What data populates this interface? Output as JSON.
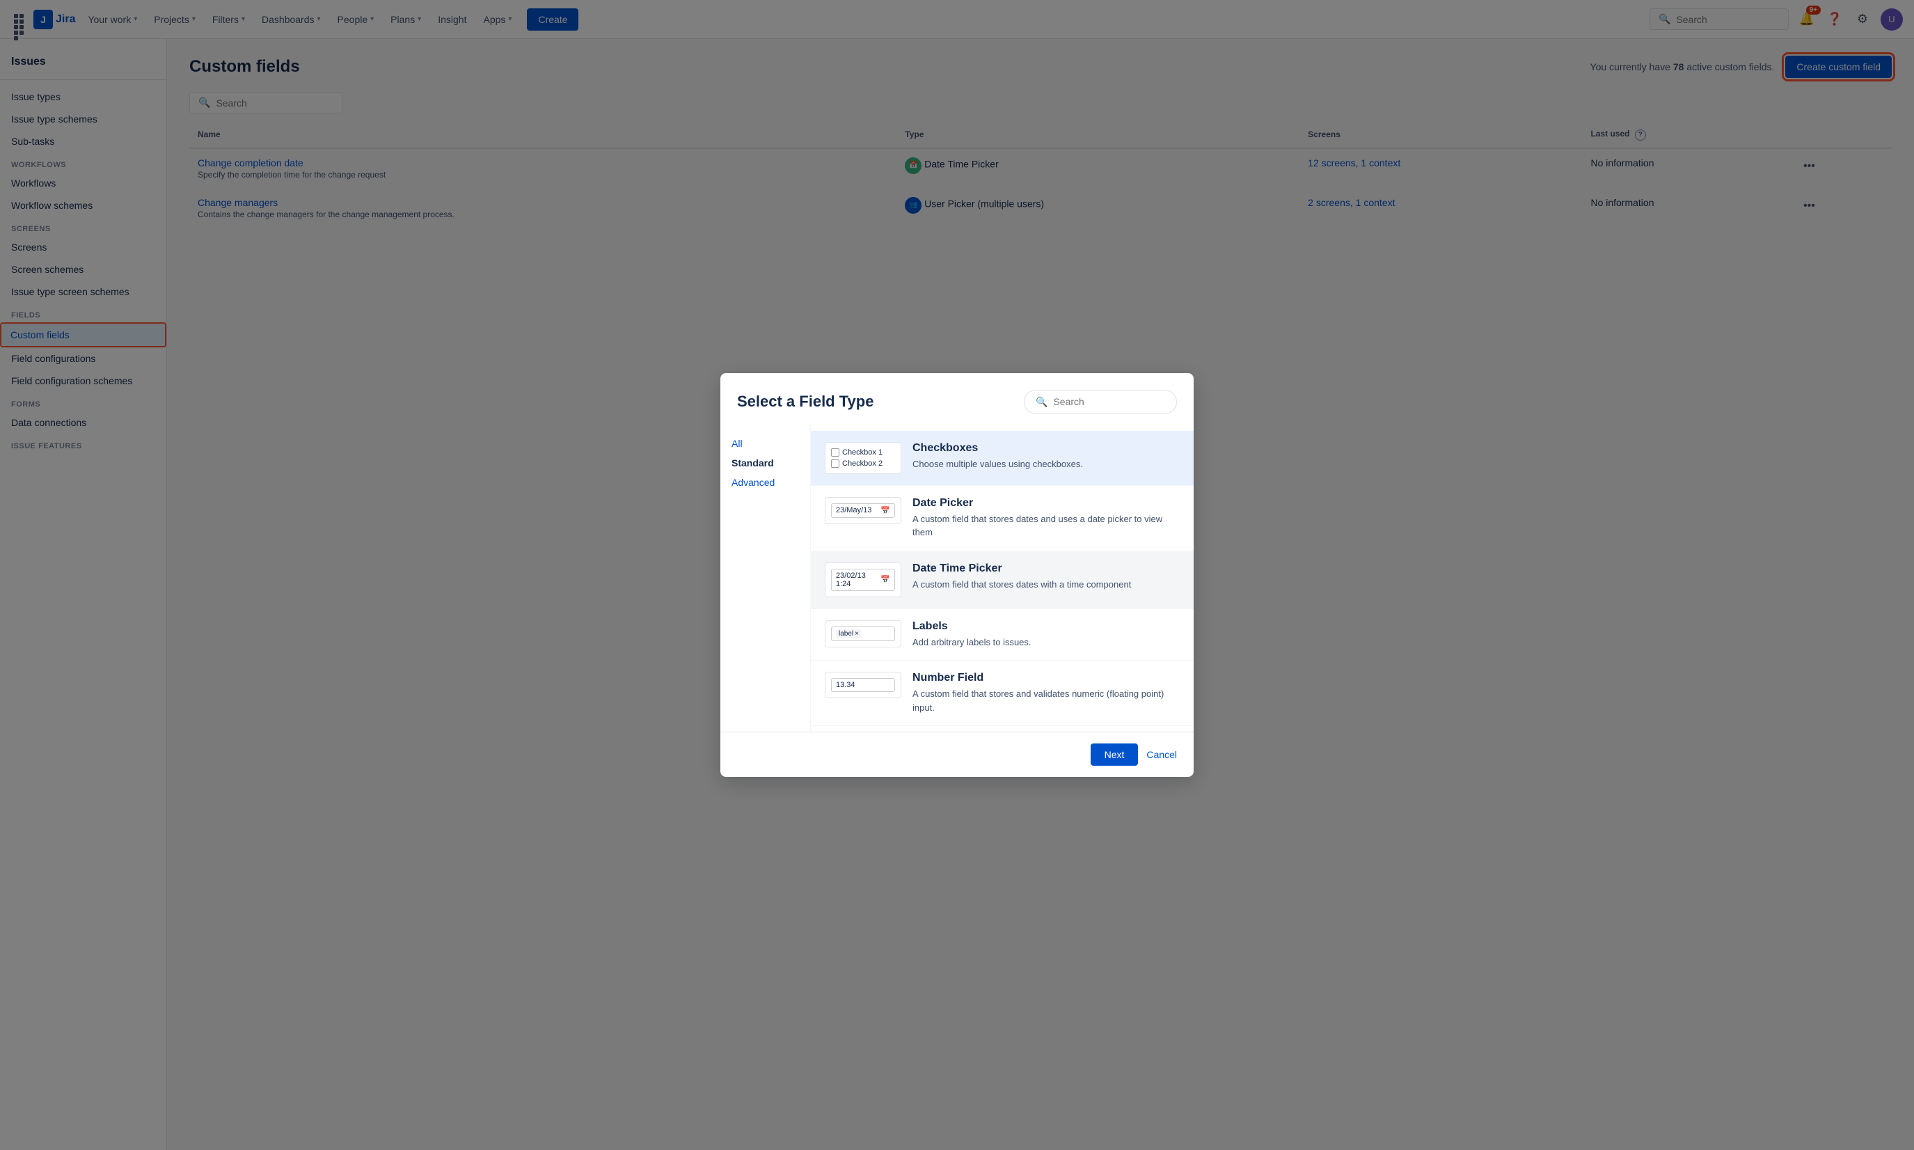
{
  "topnav": {
    "logo_text": "Jira",
    "links": [
      "Your work",
      "Projects",
      "Filters",
      "Dashboards",
      "People",
      "Plans",
      "Insight",
      "Apps"
    ],
    "create_label": "Create",
    "search_placeholder": "Search",
    "notification_count": "9+",
    "avatar_initial": "U"
  },
  "sidebar": {
    "top_label": "Issues",
    "sections": [
      {
        "items": [
          "Issue types",
          "Issue type schemes",
          "Sub-tasks"
        ]
      },
      {
        "title": "WORKFLOWS",
        "items": [
          "Workflows",
          "Workflow schemes"
        ]
      },
      {
        "title": "SCREENS",
        "items": [
          "Screens",
          "Screen schemes",
          "Issue type screen schemes"
        ]
      },
      {
        "title": "FIELDS",
        "items": [
          "Custom fields",
          "Field configurations",
          "Field configuration schemes"
        ]
      },
      {
        "title": "FORMS",
        "items": [
          "Data connections"
        ]
      },
      {
        "title": "ISSUE FEATURES",
        "items": []
      }
    ]
  },
  "main": {
    "title": "Custom fields",
    "active_count_text": "You currently have",
    "active_count_num": "78",
    "active_count_suffix": "active custom fields.",
    "create_btn_label": "Create custom field",
    "table_search_placeholder": "Search",
    "table": {
      "columns": [
        "Name",
        "Type",
        "Screens",
        "Last used"
      ],
      "rows": [
        {
          "name": "Change completion date",
          "desc": "Specify the completion time for the change request",
          "type": "Date Time Picker",
          "type_icon": "dt",
          "screens": "12 screens, 1 context",
          "last_used": "No information"
        },
        {
          "name": "Change managers",
          "desc": "Contains the change managers for the change management process.",
          "type": "User Picker (multiple users)",
          "type_icon": "user",
          "screens": "2 screens, 1 context",
          "last_used": "No information"
        }
      ]
    }
  },
  "modal": {
    "title": "Select a Field Type",
    "search_placeholder": "Search",
    "filters": [
      "All",
      "Standard",
      "Advanced"
    ],
    "active_filter": "Standard",
    "fields": [
      {
        "id": "checkboxes",
        "name": "Checkboxes",
        "desc": "Choose multiple values using checkboxes.",
        "preview_type": "checkbox",
        "preview_items": [
          "Checkbox 1",
          "Checkbox 2"
        ],
        "selected": true
      },
      {
        "id": "date-picker",
        "name": "Date Picker",
        "desc": "A custom field that stores dates and uses a date picker to view them",
        "preview_type": "date",
        "preview_text": "23/May/13",
        "selected": false
      },
      {
        "id": "date-time-picker",
        "name": "Date Time Picker",
        "desc": "A custom field that stores dates with a time component",
        "preview_type": "datetime",
        "preview_text": "23/02/13 1:24",
        "selected": false
      },
      {
        "id": "labels",
        "name": "Labels",
        "desc": "Add arbitrary labels to issues.",
        "preview_type": "label",
        "preview_text": "label",
        "selected": false
      },
      {
        "id": "number-field",
        "name": "Number Field",
        "desc": "A custom field that stores and validates numeric (floating point) input.",
        "preview_type": "number",
        "preview_text": "13.34",
        "selected": false
      }
    ],
    "next_btn_label": "Next",
    "cancel_btn_label": "Cancel"
  }
}
